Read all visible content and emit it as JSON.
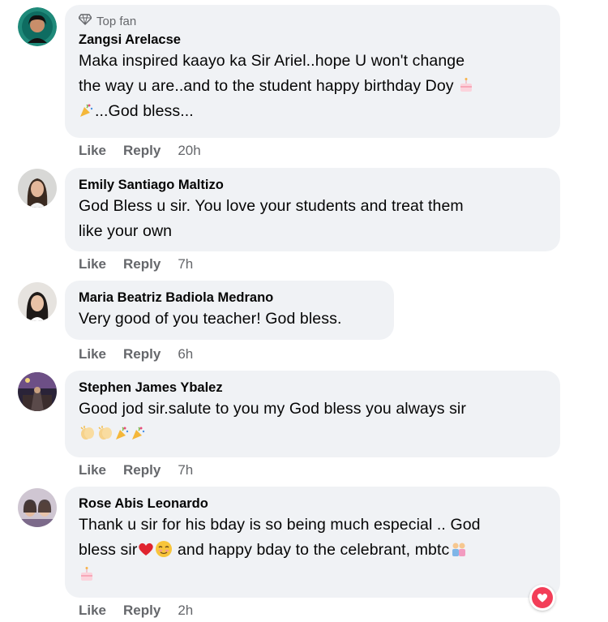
{
  "comments": [
    {
      "badge": "Top fan",
      "author": "Zangsi Arelacse",
      "lines": [
        "Maka inspired kaayo ka Sir Ariel..hope U won't change",
        "the way u are..and to the student happy birthday Doy"
      ],
      "line3": "...God bless...",
      "like": "Like",
      "reply": "Reply",
      "time": "20h",
      "emojis": [
        "cake-emoji",
        "party-popper-emoji"
      ]
    },
    {
      "author": "Emily Santiago Maltizo",
      "lines": [
        "God Bless u sir. You love your students and treat them",
        "like your own"
      ],
      "like": "Like",
      "reply": "Reply",
      "time": "7h"
    },
    {
      "author": "Maria Beatriz Badiola Medrano",
      "lines": [
        "Very good of you teacher! God bless."
      ],
      "like": "Like",
      "reply": "Reply",
      "time": "6h"
    },
    {
      "author": "Stephen James Ybalez",
      "lines": [
        "Good jod sir.salute to you my God bless you always sir"
      ],
      "like": "Like",
      "reply": "Reply",
      "time": "7h",
      "emojis": [
        "clapping-hands-emoji",
        "clapping-hands-emoji",
        "party-popper-emoji",
        "party-popper-emoji"
      ]
    },
    {
      "author": "Rose Abis Leonardo",
      "lines": [
        "Thank u sir for his bday is so being much especial .. God"
      ],
      "line2a": "bless sir",
      "line2b": " and happy bday to the celebrant, mbtc",
      "like": "Like",
      "reply": "Reply",
      "time": "2h",
      "emojis": [
        "red-heart-emoji",
        "smiling-face-emoji",
        "people-emoji",
        "cake-emoji"
      ]
    }
  ],
  "reaction_badge": {
    "icon": "heart-icon",
    "color": "#f33e58"
  },
  "colors": {
    "bubble": "#f0f2f5",
    "secondary_text": "#65676b",
    "primary_text": "#050505"
  }
}
